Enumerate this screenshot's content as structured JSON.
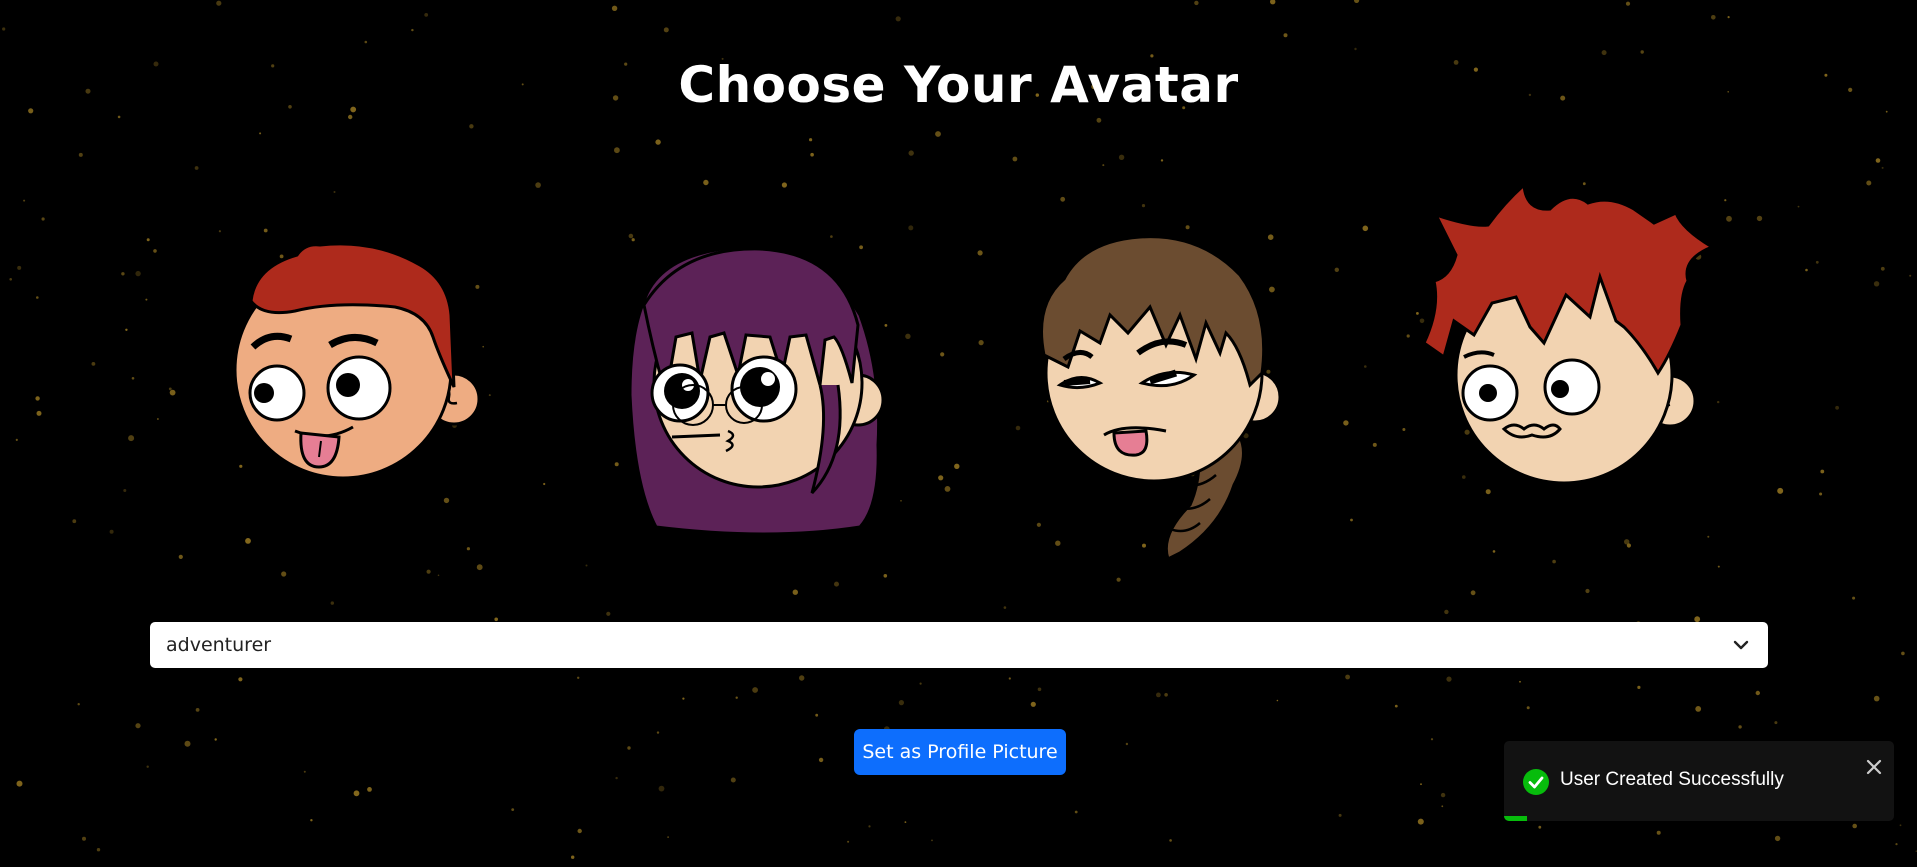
{
  "page": {
    "title": "Choose Your Avatar"
  },
  "avatars": [
    {
      "name": "avatar-1",
      "hair": "#ae2a1c",
      "skin": "#eeac82"
    },
    {
      "name": "avatar-2",
      "hair": "#5c2257",
      "skin": "#f2d3b1"
    },
    {
      "name": "avatar-3",
      "hair": "#6b4c30",
      "skin": "#f2d3b1"
    },
    {
      "name": "avatar-4",
      "hair": "#ae2a1c",
      "skin": "#f2d3b1"
    }
  ],
  "style_select": {
    "selected": "adventurer",
    "icon": "chevron-down-icon"
  },
  "actions": {
    "set_profile_label": "Set as Profile Picture"
  },
  "toast": {
    "message": "User Created Successfully",
    "icon": "check-circle-icon",
    "close_icon": "close-icon",
    "progress": 0.06,
    "accent": "#07bc0c"
  },
  "colors": {
    "background": "#000000",
    "button": "#0d6efd",
    "stars": "#8a6d1e"
  }
}
